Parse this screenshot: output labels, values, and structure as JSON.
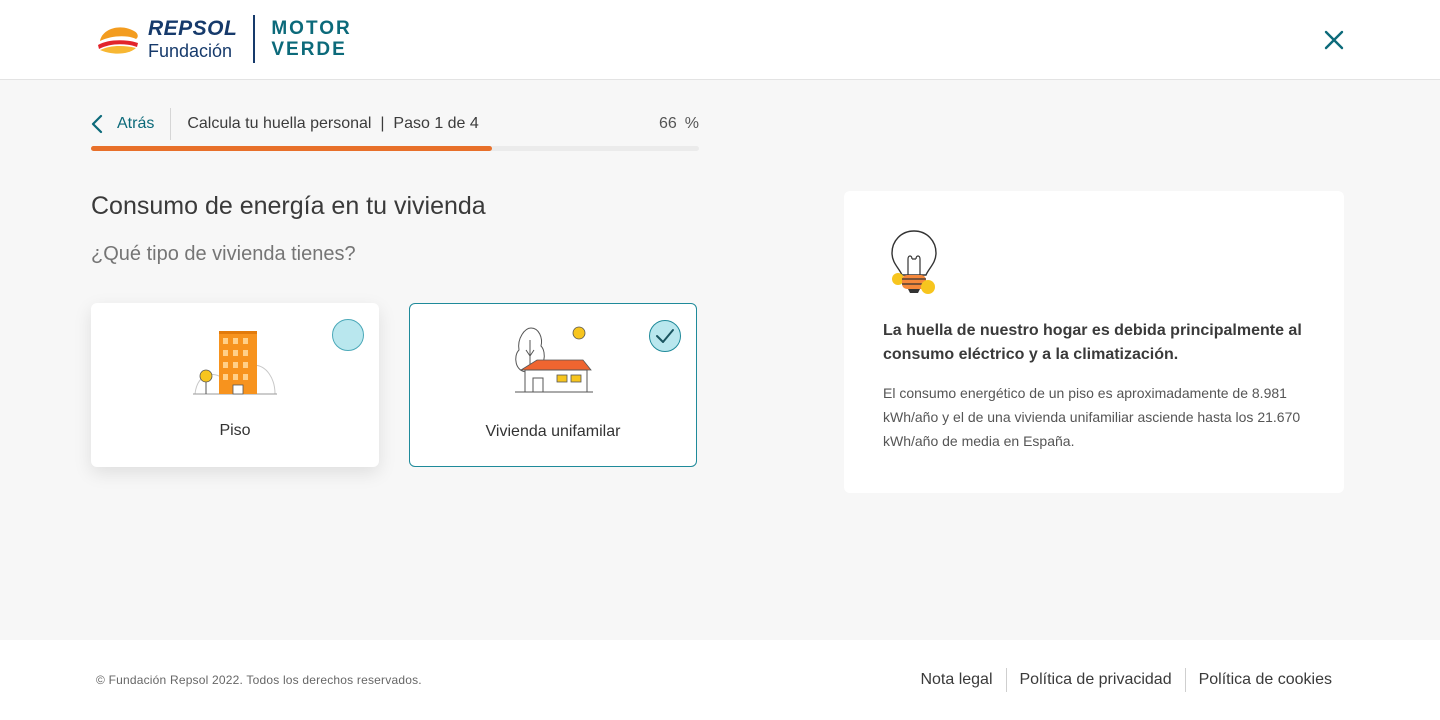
{
  "header": {
    "logo": {
      "brand": "REPSOL",
      "sub": "Fundación",
      "program_line1": "MOTOR",
      "program_line2": "VERDE"
    },
    "close_icon": "close-icon"
  },
  "progress": {
    "back_label": "Atrás",
    "step_title": "Calcula tu huella personal  |  Paso 1 de 4",
    "percent_value": "66",
    "percent_sign": "%",
    "fraction": 0.66
  },
  "question": {
    "heading": "Consumo de energía en tu vivienda",
    "prompt": "¿Qué tipo de vivienda tienes?"
  },
  "options": [
    {
      "label": "Piso",
      "selected": false,
      "icon": "apartment-building-icon"
    },
    {
      "label": "Vivienda unifamilar",
      "selected": true,
      "icon": "house-icon"
    }
  ],
  "info": {
    "icon": "lightbulb-icon",
    "title": "La huella de nuestro hogar es debida principalmente al consumo eléctrico y a la climatización.",
    "body": "El consumo energético de un piso es aproximadamente de 8.981 kWh/año y el de una vivienda unifamiliar asciende hasta los 21.670 kWh/año de media en España."
  },
  "footer": {
    "copyright": "© Fundación Repsol 2022. Todos los derechos reservados.",
    "links": [
      "Nota legal",
      "Política de privacidad",
      "Política de cookies"
    ]
  },
  "colors": {
    "accent_teal": "#0c6a7a",
    "accent_orange": "#e8702a",
    "brand_navy": "#163a6b",
    "selected_border": "#1f8a9a",
    "radio_fill": "#b9e7ee"
  }
}
